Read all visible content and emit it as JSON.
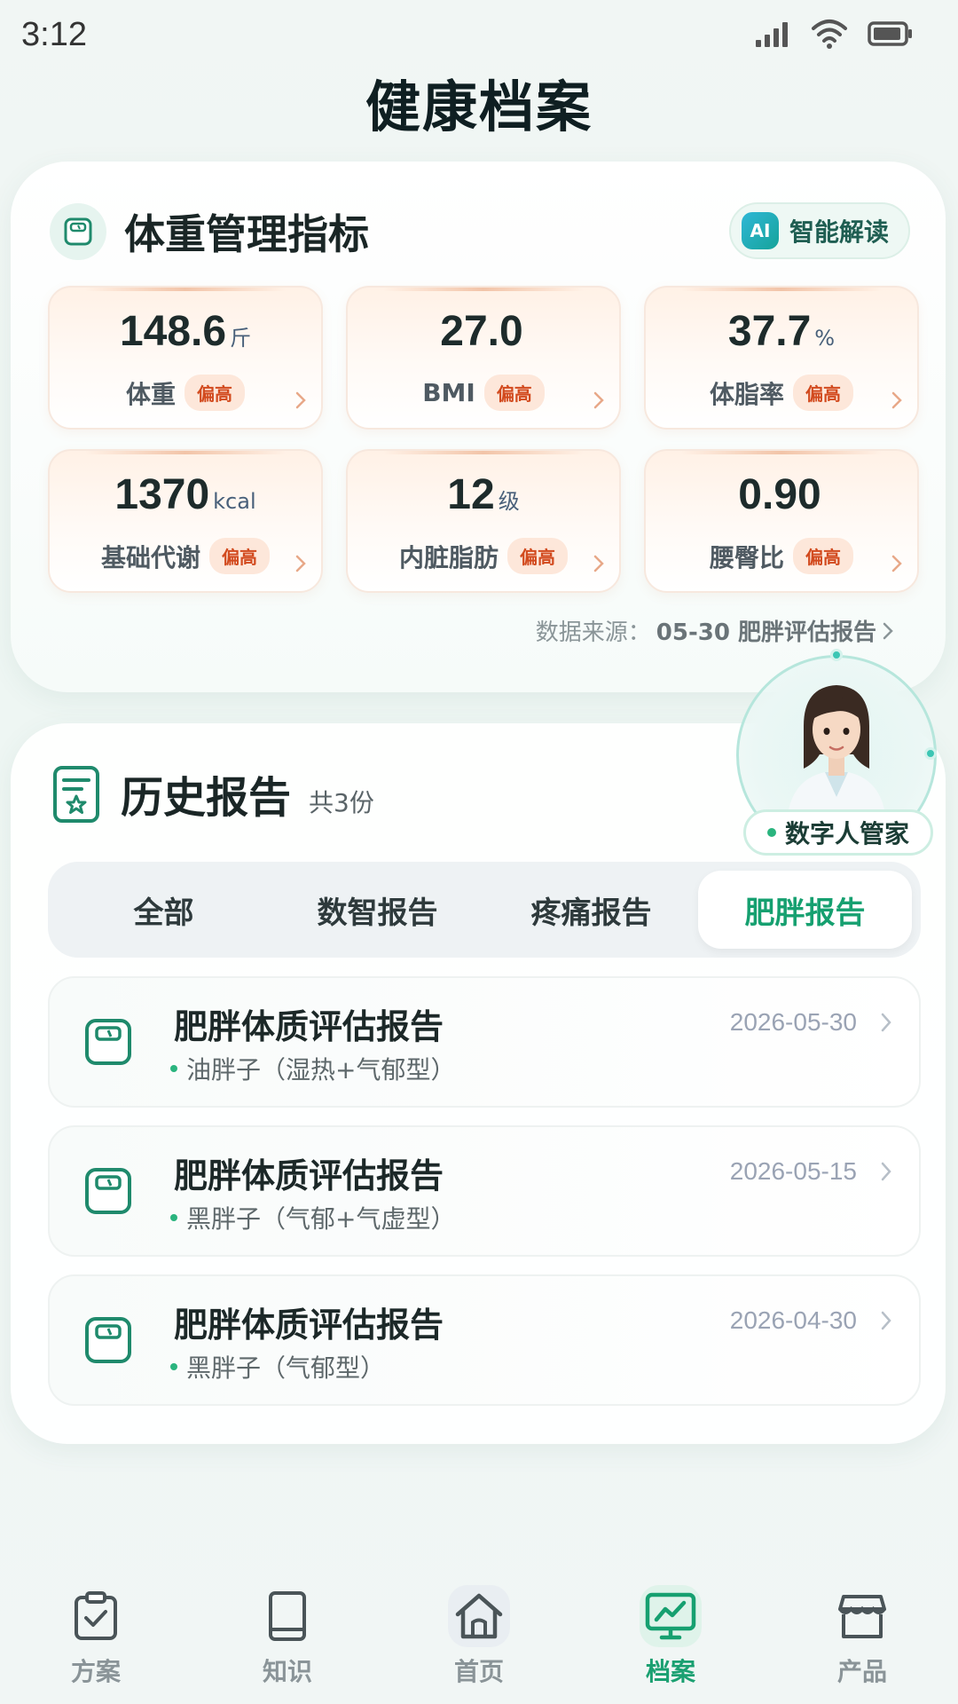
{
  "status_bar": {
    "time": "3:12"
  },
  "page_title": "健康档案",
  "metrics_section": {
    "title": "体重管理指标",
    "ai_button": {
      "badge": "AI",
      "label": "智能解读"
    },
    "metrics": [
      {
        "value": "148.6",
        "unit": "斤",
        "label": "体重",
        "tag": "偏高"
      },
      {
        "value": "27.0",
        "unit": "",
        "label": "BMI",
        "tag": "偏高"
      },
      {
        "value": "37.7",
        "unit": "%",
        "label": "体脂率",
        "tag": "偏高"
      },
      {
        "value": "1370",
        "unit": "kcal",
        "label": "基础代谢",
        "tag": "偏高"
      },
      {
        "value": "12",
        "unit": "级",
        "label": "内脏脂肪",
        "tag": "偏高"
      },
      {
        "value": "0.90",
        "unit": "",
        "label": "腰臀比",
        "tag": "偏高"
      }
    ],
    "source_prefix": "数据来源：",
    "source_value": "05-30 肥胖评估报告"
  },
  "history_section": {
    "title": "历史报告",
    "count": "共3份",
    "tabs": [
      {
        "label": "全部",
        "active": false
      },
      {
        "label": "数智报告",
        "active": false
      },
      {
        "label": "疼痛报告",
        "active": false
      },
      {
        "label": "肥胖报告",
        "active": true
      }
    ],
    "reports": [
      {
        "title": "肥胖体质评估报告",
        "subtitle": "油胖子（湿热+气郁型）",
        "date": "2026-05-30"
      },
      {
        "title": "肥胖体质评估报告",
        "subtitle": "黑胖子（气郁+气虚型）",
        "date": "2026-05-15"
      },
      {
        "title": "肥胖体质评估报告",
        "subtitle": "黑胖子（气郁型）",
        "date": "2026-04-30"
      }
    ]
  },
  "digital_assistant": {
    "label": "数字人管家"
  },
  "bottom_nav": {
    "items": [
      {
        "label": "方案",
        "icon": "clipboard-check-icon"
      },
      {
        "label": "知识",
        "icon": "book-icon"
      },
      {
        "label": "首页",
        "icon": "home-icon"
      },
      {
        "label": "档案",
        "icon": "chart-monitor-icon",
        "active": true
      },
      {
        "label": "产品",
        "icon": "store-icon"
      }
    ]
  },
  "colors": {
    "accent": "#16a070",
    "warning": "#d24a1e",
    "warning_bg": "#fde7da"
  }
}
